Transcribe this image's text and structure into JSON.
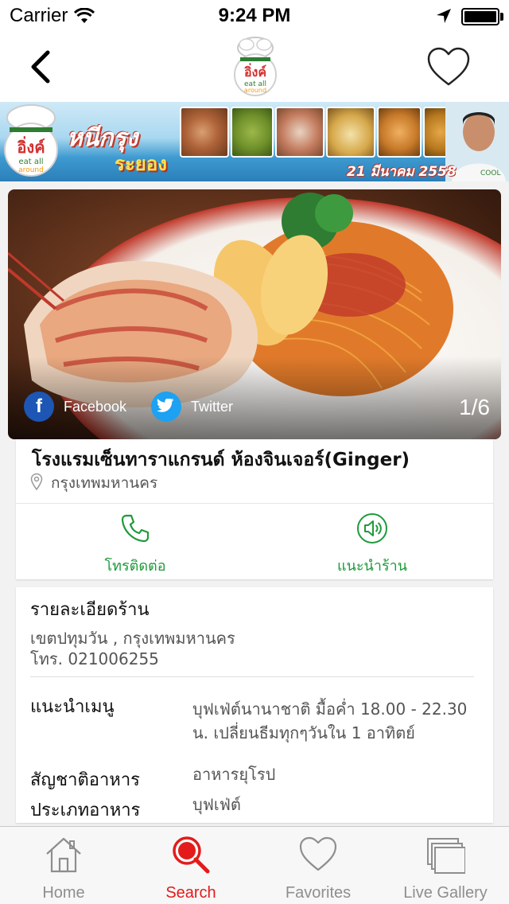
{
  "status_bar": {
    "carrier": "Carrier",
    "time": "9:24 PM"
  },
  "nav": {
    "back_icon": "chevron-left-icon",
    "favorite_icon": "heart-outline-icon"
  },
  "banner": {
    "logo_text_top": "COOL",
    "logo_text_main": "อิ่งค์",
    "logo_text_sub": "eat all around",
    "title_line1": "หนีกรุง",
    "title_line2": "ระยอง",
    "date": "21 มีนาคม 2558"
  },
  "photo": {
    "share_facebook": "Facebook",
    "share_twitter": "Twitter",
    "counter": "1/6"
  },
  "place": {
    "name": "โรงแรมเซ็นทาราแกรนด์ ห้องจินเจอร์(Ginger)",
    "location": "กรุงเทพมหานคร"
  },
  "actions": {
    "call_label": "โทรติดต่อ",
    "recommend_label": "แนะนำร้าน",
    "accent_color": "#1f9a3b"
  },
  "details": {
    "title": "รายละเอียดร้าน",
    "address": "เขตปทุมวัน    , กรุงเทพมหานคร",
    "phone": "โทร. 021006255",
    "menu_label": "แนะนำเมนู",
    "menu_value": "บุฟเฟ่ต์นานาชาติ มื้อค่ำ 18.00 - 22.30 น. เปลี่ยนธีมทุกๆวันใน 1 อาทิตย์",
    "cuisine_label": "สัญชาติอาหาร",
    "cuisine_value": "อาหารยุโรป",
    "type_label": "ประเภทอาหาร",
    "type_value": "บุฟเฟ่ต์"
  },
  "tabs": [
    {
      "label": "Home",
      "icon": "home-icon",
      "active": false
    },
    {
      "label": "Search",
      "icon": "search-icon",
      "active": true
    },
    {
      "label": "Favorites",
      "icon": "heart-icon",
      "active": false
    },
    {
      "label": "Live Gallery",
      "icon": "gallery-icon",
      "active": false
    }
  ],
  "colors": {
    "active_tab": "#e31b1b",
    "inactive_tab": "#8e8e8e",
    "brand_red": "#d32f2f"
  }
}
